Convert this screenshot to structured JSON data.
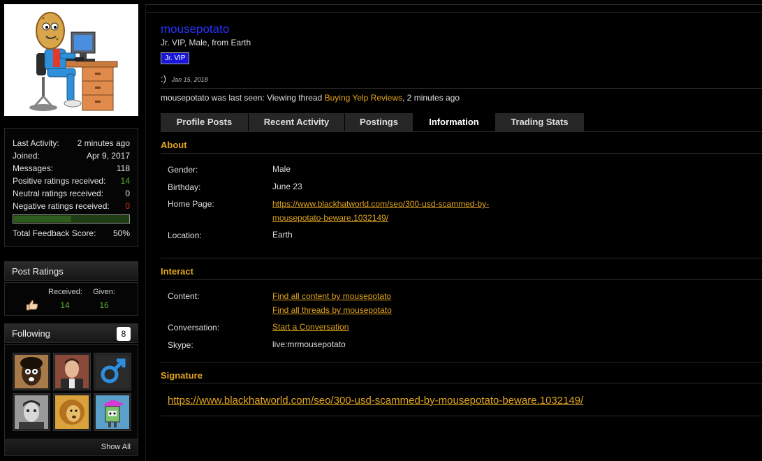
{
  "sidebar": {
    "stats": [
      {
        "label": "Last Activity:",
        "value": "2 minutes ago"
      },
      {
        "label": "Joined:",
        "value": "Apr 9, 2017"
      },
      {
        "label": "Messages:",
        "value": "118"
      },
      {
        "label": "Positive ratings received:",
        "value": "14"
      },
      {
        "label": "Neutral ratings received:",
        "value": "0"
      },
      {
        "label": "Negative ratings received:",
        "value": "0"
      }
    ],
    "feedback_fraction": 0.5,
    "total_feedback_label": "Total Feedback Score:",
    "total_feedback_value": "50%",
    "post_ratings": {
      "title": "Post Ratings",
      "received_label": "Received:",
      "given_label": "Given:",
      "received_value": "14",
      "given_value": "16",
      "icon": "thumbs-up-icon"
    },
    "following": {
      "title": "Following",
      "count": "8",
      "show_all": "Show All"
    }
  },
  "profile": {
    "username": "mousepotato",
    "title_line": "Jr. VIP, Male, from Earth",
    "badge": "Jr. VIP",
    "status_text": ":)",
    "status_date": "Jan 15, 2018",
    "last_seen_prefix": "mousepotato was last seen: Viewing thread",
    "last_seen_thread": "Buying Yelp Reviews",
    "last_seen_suffix": ", 2 minutes ago"
  },
  "tabs": [
    {
      "label": "Profile Posts"
    },
    {
      "label": "Recent Activity"
    },
    {
      "label": "Postings"
    },
    {
      "label": "Information"
    },
    {
      "label": "Trading Stats"
    }
  ],
  "about": {
    "title": "About",
    "gender_label": "Gender:",
    "gender": "Male",
    "birthday_label": "Birthday:",
    "birthday": "June 23",
    "homepage_label": "Home Page:",
    "homepage_line1": "https://www.blackhatworld.com/seo/300-usd-scammed-by-",
    "homepage_line2": "mousepotato-beware.1032149/",
    "location_label": "Location:",
    "location": "Earth"
  },
  "interact": {
    "title": "Interact",
    "content_label": "Content:",
    "find_content": "Find all content by mousepotato",
    "find_threads": "Find all threads by mousepotato",
    "conversation_label": "Conversation:",
    "start_conversation": "Start a Conversation",
    "skype_label": "Skype:",
    "skype": "live:mrmousepotato"
  },
  "signature": {
    "title": "Signature",
    "link": "https://www.blackhatworld.com/seo/300-usd-scammed-by-mousepotato-beware.1032149/"
  },
  "colors": {
    "accent": "#e1a51e",
    "username": "#2a33ff",
    "badge_bg": "#1a17d9",
    "positive": "#5ab22c",
    "negative": "#d12f20"
  }
}
